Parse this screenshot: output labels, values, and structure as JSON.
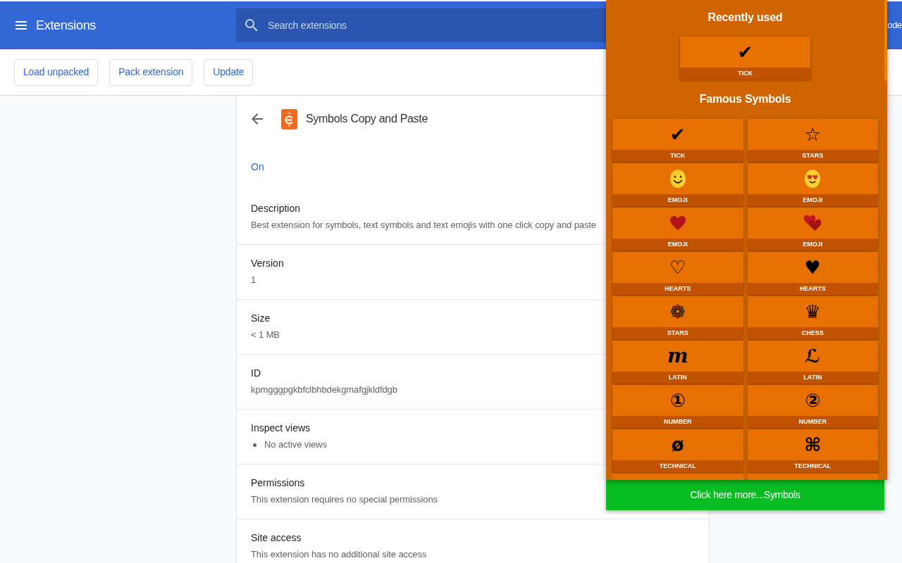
{
  "header": {
    "title": "Extensions",
    "search": {
      "placeholder": "Search extensions"
    },
    "right_label_cut": "ode"
  },
  "toolbar": {
    "buttons": [
      "Load unpacked",
      "Pack extension",
      "Update"
    ]
  },
  "details": {
    "title": "Symbols Copy and Paste",
    "status": "On",
    "sections": [
      {
        "kind": "text",
        "label": "Description",
        "value": "Best extension for symbols, text symbols and text emojis with one click copy and paste"
      },
      {
        "kind": "text",
        "label": "Version",
        "value": "1"
      },
      {
        "kind": "text",
        "label": "Size",
        "value": "< 1 MB"
      },
      {
        "kind": "text",
        "label": "ID",
        "value": "kpmgggpgkbfclbhbdekgmafgjkldfdgb"
      },
      {
        "kind": "list",
        "label": "Inspect views",
        "bullets": [
          "No active views"
        ]
      },
      {
        "kind": "text",
        "label": "Permissions",
        "value": "This extension requires no special permissions"
      },
      {
        "kind": "text",
        "label": "Site access",
        "value": "This extension has no additional site access"
      }
    ]
  },
  "popup": {
    "recent_title": "Recently used",
    "recent": [
      {
        "kind": "glyph",
        "symbol": "✔",
        "label": "TICK"
      }
    ],
    "famous_title": "Famous Symbols",
    "symbols": [
      {
        "kind": "glyph",
        "symbol": "✔",
        "label": "TICK"
      },
      {
        "kind": "glyph",
        "symbol": "☆",
        "label": "STARS"
      },
      {
        "kind": "smiley",
        "label": "EMOJI"
      },
      {
        "kind": "lovestruck",
        "label": "EMOJI"
      },
      {
        "kind": "heart",
        "label": "EMOJI"
      },
      {
        "kind": "hearts",
        "label": "EMOJI"
      },
      {
        "kind": "glyph",
        "symbol": "♡",
        "label": "HEARTS"
      },
      {
        "kind": "glyph",
        "symbol": "♥",
        "label": "HEARTS"
      },
      {
        "kind": "glyph",
        "symbol": "❁",
        "label": "STARS"
      },
      {
        "kind": "glyph",
        "symbol": "♛",
        "label": "CHESS"
      },
      {
        "kind": "script",
        "symbol": "m",
        "label": "LATIN"
      },
      {
        "kind": "glyph",
        "symbol": "ℒ",
        "label": "LATIN"
      },
      {
        "kind": "glyph",
        "symbol": "①",
        "label": "NUMBER"
      },
      {
        "kind": "glyph",
        "symbol": "②",
        "label": "NUMBER"
      },
      {
        "kind": "glyph",
        "symbol": "ø",
        "label": "TECHNICAL"
      },
      {
        "kind": "glyph",
        "symbol": "⌘",
        "label": "TECHNICAL"
      }
    ],
    "cut_off_row": [
      {
        "kind": "tile"
      },
      {
        "kind": "tile"
      }
    ],
    "more_button": "Click here more...Symbols"
  }
}
